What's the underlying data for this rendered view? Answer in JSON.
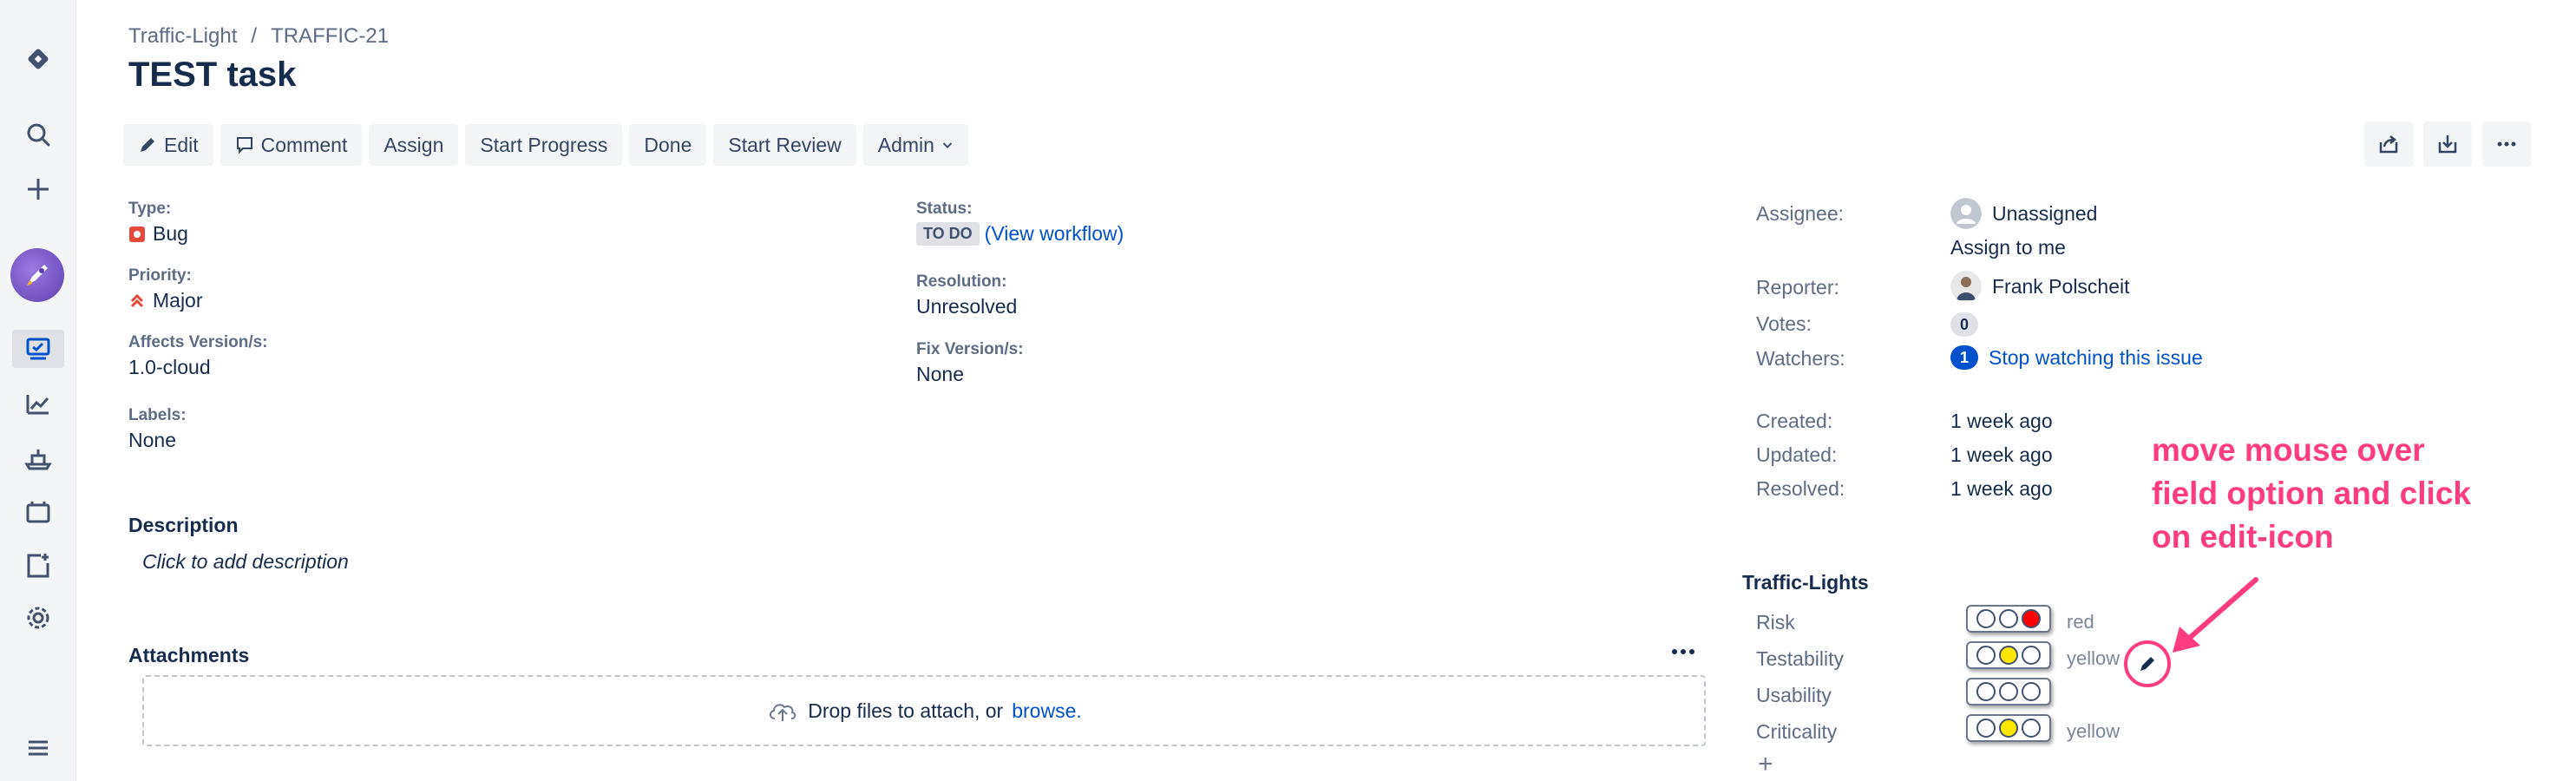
{
  "colors": {
    "accent": "#0052cc",
    "annotation": "#ff3c82",
    "risk_red": "#ff0000",
    "yellow": "#ffe600"
  },
  "sidebar": {
    "icons": [
      "jira-logo-icon",
      "search-icon",
      "create-plus-icon",
      "project-avatar",
      "board-icon",
      "reports-icon",
      "releases-icon",
      "components-icon",
      "add-item-icon",
      "settings-gear-icon",
      "menu-icon"
    ]
  },
  "breadcrumb": {
    "project": "Traffic-Light",
    "separator": "/",
    "issue_key": "TRAFFIC-21"
  },
  "issue": {
    "title": "TEST task"
  },
  "toolbar": {
    "edit": "Edit",
    "comment": "Comment",
    "assign": "Assign",
    "start_progress": "Start Progress",
    "done": "Done",
    "start_review": "Start Review",
    "admin": "Admin"
  },
  "details": {
    "type_label": "Type:",
    "type_value": "Bug",
    "priority_label": "Priority:",
    "priority_value": "Major",
    "affects_label": "Affects Version/s:",
    "affects_value": "1.0-cloud",
    "labels_label": "Labels:",
    "labels_value": "None",
    "status_label": "Status:",
    "status_value": "TO DO",
    "view_workflow_open": "(",
    "view_workflow": "View workflow",
    "view_workflow_close": ")",
    "resolution_label": "Resolution:",
    "resolution_value": "Unresolved",
    "fix_label": "Fix Version/s:",
    "fix_value": "None"
  },
  "description": {
    "title": "Description",
    "placeholder": "Click to add description"
  },
  "attachments": {
    "title": "Attachments",
    "drop_text": "Drop files to attach, or",
    "browse": "browse."
  },
  "people": {
    "assignee_label": "Assignee:",
    "assignee_value": "Unassigned",
    "assign_to_me": "Assign to me",
    "reporter_label": "Reporter:",
    "reporter_value": "Frank Polscheit",
    "votes_label": "Votes:",
    "votes_count": "0",
    "watchers_label": "Watchers:",
    "watchers_count": "1",
    "stop_watching": "Stop watching this issue"
  },
  "dates": {
    "created_label": "Created:",
    "created_value": "1 week ago",
    "updated_label": "Updated:",
    "updated_value": "1 week ago",
    "resolved_label": "Resolved:",
    "resolved_value": "1 week ago"
  },
  "traffic_lights": {
    "title": "Traffic-Lights",
    "items": [
      {
        "label": "Risk",
        "value": "red",
        "lit": [
          false,
          false,
          true
        ]
      },
      {
        "label": "Testability",
        "value": "yellow",
        "lit": [
          false,
          true,
          false
        ]
      },
      {
        "label": "Usability",
        "value": "",
        "lit": [
          false,
          false,
          false
        ]
      },
      {
        "label": "Criticality",
        "value": "yellow",
        "lit": [
          false,
          true,
          false
        ]
      }
    ],
    "add": "+"
  },
  "annotation": {
    "line1": "move mouse over",
    "line2": "field option and click",
    "line3": "on edit-icon"
  }
}
